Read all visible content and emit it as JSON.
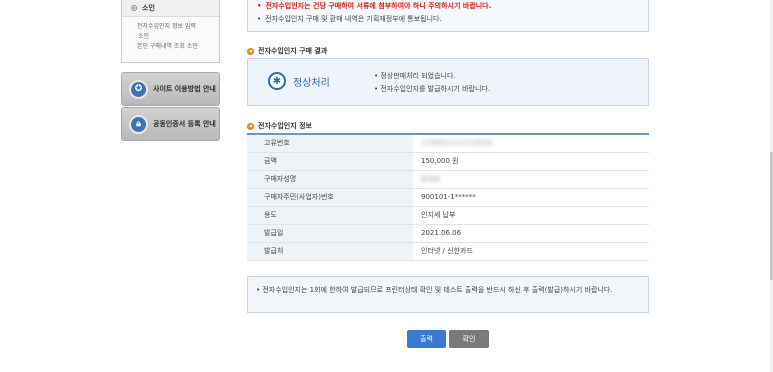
{
  "sidebar": {
    "head": "소인",
    "sub_items": [
      "전자수입인지 정보 입력",
      "소인",
      "본인 구매내역 조회 소인"
    ],
    "guide_buttons": [
      {
        "label": "사이트 이용방법 안내",
        "icon": "compass-icon"
      },
      {
        "label": "공동인증서 등록 안내",
        "icon": "lock-icon"
      }
    ]
  },
  "notice": {
    "line1": "전자수입인지는 건당 구매하여 서류에 첨부하여야 하니 주의하시기 바랍니다.",
    "line2": "전자수입인지 구매 및 환매 내역은 기획재정부에 통보됩니다."
  },
  "result_section": {
    "title": "전자수입인지 구매 결과",
    "status": "정상처리",
    "messages": [
      "정상판매처리 되었습니다.",
      "전자수입인지를 발급하시기 바랍니다."
    ]
  },
  "info_section": {
    "title": "전자수입인지 정보",
    "rows": [
      {
        "label": "고유번호",
        "value": "2106021112110000"
      },
      {
        "label": "금액",
        "value": "150,000 원"
      },
      {
        "label": "구매자성명",
        "value": "홍길동"
      },
      {
        "label": "구매자주민(사업자)번호",
        "value": "900101-1******"
      },
      {
        "label": "용도",
        "value": "인지세 납부"
      },
      {
        "label": "발급일",
        "value": "2021.06.06"
      },
      {
        "label": "발급처",
        "value": "인터넷 / 신한카드"
      }
    ]
  },
  "footer_note": "전자수입인지는 1회에 한하여 발급되므로 프린터상태 확인 및 테스트 출력을 반드시 하신 후 출력(발급)하시기 바랍니다.",
  "buttons": {
    "print": "출력",
    "confirm": "확인"
  },
  "colors": {
    "accent_blue": "#3a7ad1",
    "notice_red": "#d71a1a",
    "section_orange": "#f29a2e"
  }
}
